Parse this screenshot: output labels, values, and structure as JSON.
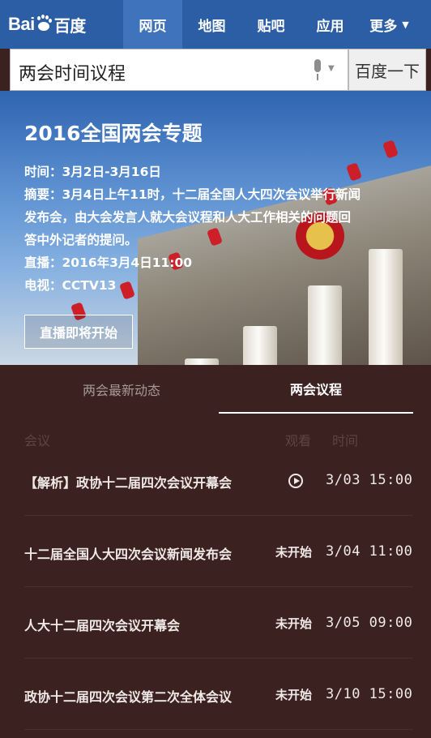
{
  "header": {
    "logo_text": "Bai",
    "logo_text_after": "百度",
    "nav": [
      {
        "label": "网页",
        "active": true
      },
      {
        "label": "地图",
        "active": false
      },
      {
        "label": "贴吧",
        "active": false
      },
      {
        "label": "应用",
        "active": false
      },
      {
        "label": "更多",
        "active": false
      }
    ],
    "nav_more_icon": "chevron-down-icon"
  },
  "search": {
    "query": "两会时间议程",
    "button_label": "百度一下",
    "mic_icon": "microphone-icon"
  },
  "hero": {
    "title": "2016全国两会专题",
    "lines": [
      "时间：3月2日-3月16日",
      "摘要：3月4日上午11时，十二届全国人大四次会议举行新闻",
      "发布会，由大会发言人就大会议程和人大工作相关的问题回",
      "答中外记者的提问。",
      "直播：2016年3月4日11:00",
      "电视：CCTV13"
    ],
    "live_button": "直播即将开始"
  },
  "tabs": [
    {
      "label": "两会最新动态",
      "active": false
    },
    {
      "label": "两会议程",
      "active": true
    }
  ],
  "table": {
    "headers": {
      "meeting": "会议",
      "watch": "观看",
      "time": "时间"
    },
    "rows": [
      {
        "name": "【解析】政协十二届四次会议开幕会",
        "watch": "",
        "watch_icon": "play-icon",
        "time": "3/03 15:00"
      },
      {
        "name": "十二届全国人大四次会议新闻发布会",
        "watch": "未开始",
        "time": "3/04 11:00"
      },
      {
        "name": "人大十二届四次会议开幕会",
        "watch": "未开始",
        "time": "3/05 09:00"
      },
      {
        "name": "政协十二届四次会议第二次全体会议",
        "watch": "未开始",
        "time": "3/10 15:00"
      }
    ]
  },
  "colors": {
    "header_bg": "#2c5ea6",
    "nav_active_bg": "#3f74bd",
    "panel_bg": "#3b211f"
  }
}
